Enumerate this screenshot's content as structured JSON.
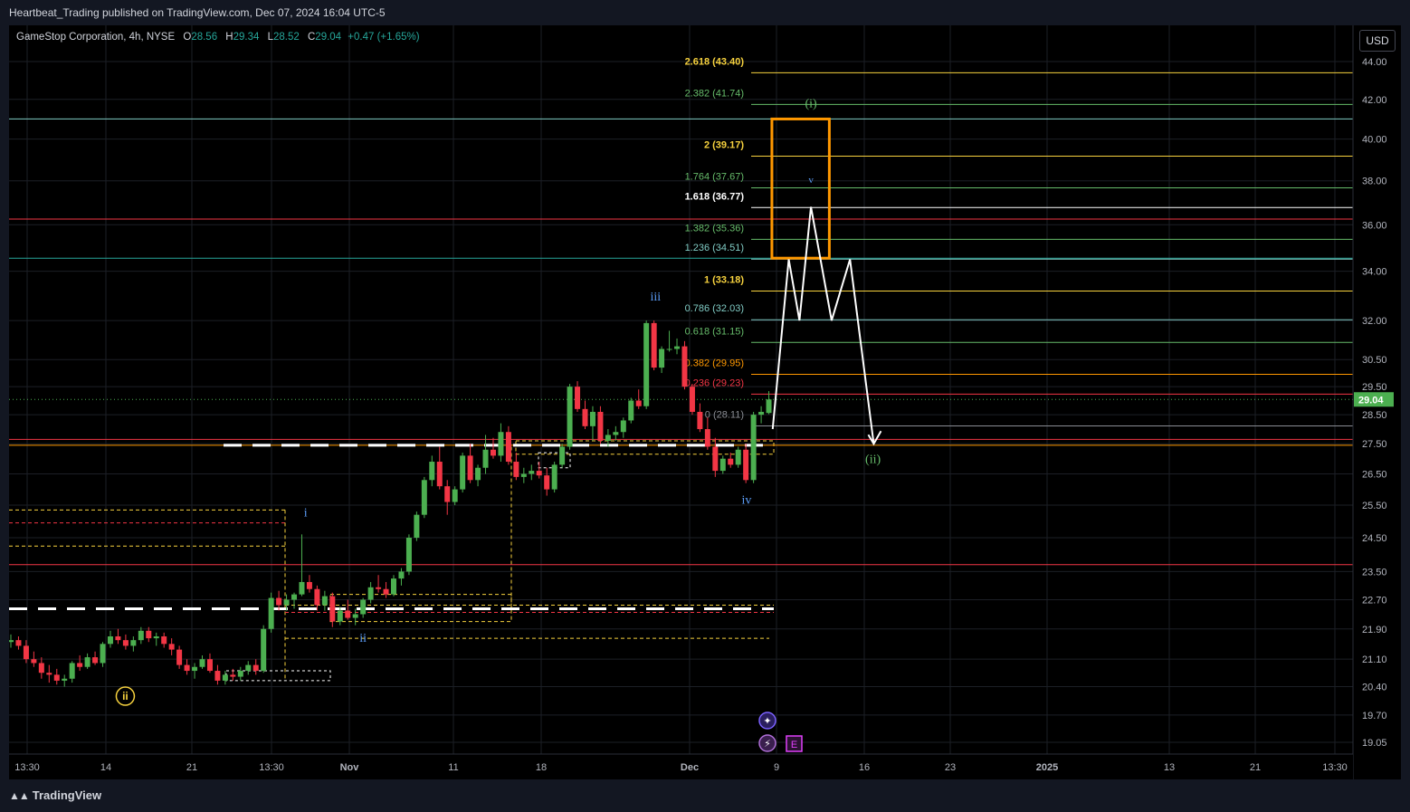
{
  "header": {
    "published_line": "Heartbeat_Trading published on TradingView.com, Dec 07, 2024 16:04 UTC-5"
  },
  "legend": {
    "symbol": "GameStop Corporation, 4h, NYSE",
    "o_label": "O",
    "o_value": "28.56",
    "h_label": "H",
    "h_value": "29.34",
    "l_label": "L",
    "l_value": "28.52",
    "c_label": "C",
    "c_value": "29.04",
    "change": "+0.47 (+1.65%)"
  },
  "currency": "USD",
  "footer": {
    "brand": "TradingView"
  },
  "colors": {
    "up": "#4caf50",
    "down": "#f23645",
    "fib_yellow": "#f7d23e",
    "fib_teal": "#80cbc4",
    "fib_green": "#66bb6a",
    "fib_orange": "#ff9800",
    "fib_red": "#f23645",
    "box": "#ff9800",
    "projection": "#ffffff",
    "wave_blue": "#5b9cf6",
    "wave_green": "#66bb6a",
    "price_tag": "#4caf50"
  },
  "chart_data": {
    "type": "candlestick",
    "price_axis": {
      "ticks": [
        44.0,
        42.0,
        40.0,
        38.0,
        36.0,
        34.0,
        32.0,
        30.5,
        29.5,
        28.5,
        27.5,
        26.5,
        25.5,
        24.5,
        23.5,
        22.7,
        21.9,
        21.1,
        20.4,
        19.7,
        19.05
      ],
      "tick_labels": [
        "44.00",
        "42.00",
        "40.00",
        "38.00",
        "36.00",
        "34.00",
        "32.00",
        "30.50",
        "29.50",
        "28.50",
        "27.50",
        "26.50",
        "25.50",
        "24.50",
        "23.50",
        "22.70",
        "21.90",
        "21.10",
        "20.40",
        "19.70",
        "19.05"
      ],
      "log_scale": true,
      "current_price": 29.04,
      "current_price_label": "29.04"
    },
    "time_axis": {
      "labels": [
        "13:30",
        "14",
        "21",
        "13:30",
        "Nov",
        "11",
        "18",
        "Dec",
        "9",
        "16",
        "23",
        "2025",
        "13",
        "21",
        "13:30"
      ],
      "bold_labels": [
        "Nov",
        "Dec",
        "2025"
      ]
    },
    "candles": [
      [
        21.55,
        21.75,
        21.4,
        21.6
      ],
      [
        21.6,
        21.7,
        21.35,
        21.45
      ],
      [
        21.45,
        21.6,
        21.0,
        21.1
      ],
      [
        21.1,
        21.3,
        20.9,
        21.0
      ],
      [
        21.0,
        21.15,
        20.6,
        20.75
      ],
      [
        20.75,
        20.95,
        20.5,
        20.7
      ],
      [
        20.7,
        20.85,
        20.45,
        20.55
      ],
      [
        20.55,
        20.7,
        20.4,
        20.6
      ],
      [
        20.6,
        21.05,
        20.5,
        21.0
      ],
      [
        21.0,
        21.2,
        20.8,
        20.9
      ],
      [
        20.9,
        21.25,
        20.85,
        21.15
      ],
      [
        21.15,
        21.3,
        20.95,
        21.0
      ],
      [
        21.0,
        21.55,
        20.9,
        21.5
      ],
      [
        21.5,
        21.85,
        21.4,
        21.7
      ],
      [
        21.7,
        21.9,
        21.5,
        21.6
      ],
      [
        21.6,
        21.75,
        21.35,
        21.45
      ],
      [
        21.45,
        21.7,
        21.3,
        21.6
      ],
      [
        21.6,
        21.95,
        21.5,
        21.85
      ],
      [
        21.85,
        21.95,
        21.55,
        21.65
      ],
      [
        21.65,
        21.8,
        21.45,
        21.7
      ],
      [
        21.7,
        21.8,
        21.4,
        21.5
      ],
      [
        21.5,
        21.65,
        21.2,
        21.35
      ],
      [
        21.35,
        21.45,
        20.85,
        20.95
      ],
      [
        20.95,
        21.1,
        20.7,
        20.8
      ],
      [
        20.8,
        21.0,
        20.6,
        20.9
      ],
      [
        20.9,
        21.2,
        20.85,
        21.1
      ],
      [
        21.1,
        21.25,
        20.75,
        20.8
      ],
      [
        20.8,
        20.95,
        20.45,
        20.55
      ],
      [
        20.55,
        20.8,
        20.45,
        20.7
      ],
      [
        20.7,
        20.85,
        20.55,
        20.65
      ],
      [
        20.65,
        20.9,
        20.55,
        20.8
      ],
      [
        20.8,
        21.05,
        20.7,
        20.95
      ],
      [
        20.95,
        21.1,
        20.7,
        20.8
      ],
      [
        20.8,
        22.0,
        20.75,
        21.9
      ],
      [
        21.9,
        22.9,
        21.8,
        22.75
      ],
      [
        22.75,
        22.95,
        22.4,
        22.55
      ],
      [
        22.55,
        22.85,
        22.4,
        22.7
      ],
      [
        22.7,
        22.9,
        22.45,
        22.85
      ],
      [
        22.85,
        24.6,
        22.8,
        23.2
      ],
      [
        23.2,
        23.4,
        22.9,
        23.0
      ],
      [
        23.0,
        23.1,
        22.4,
        22.55
      ],
      [
        22.55,
        22.95,
        22.4,
        22.8
      ],
      [
        22.8,
        22.9,
        21.95,
        22.1
      ],
      [
        22.1,
        22.5,
        22.0,
        22.4
      ],
      [
        22.4,
        22.7,
        22.15,
        22.2
      ],
      [
        22.2,
        22.45,
        22.0,
        22.3
      ],
      [
        22.3,
        22.75,
        22.2,
        22.7
      ],
      [
        22.7,
        23.2,
        22.6,
        23.05
      ],
      [
        23.05,
        23.4,
        22.9,
        23.0
      ],
      [
        23.0,
        23.2,
        22.75,
        22.85
      ],
      [
        22.85,
        23.4,
        22.8,
        23.3
      ],
      [
        23.3,
        23.6,
        23.1,
        23.5
      ],
      [
        23.5,
        24.6,
        23.4,
        24.5
      ],
      [
        24.5,
        25.3,
        24.4,
        25.2
      ],
      [
        25.2,
        26.4,
        25.1,
        26.3
      ],
      [
        26.3,
        27.1,
        26.1,
        26.9
      ],
      [
        26.9,
        27.4,
        26.0,
        26.1
      ],
      [
        26.1,
        26.3,
        25.2,
        25.6
      ],
      [
        25.6,
        26.1,
        25.5,
        26.0
      ],
      [
        26.0,
        27.2,
        25.9,
        27.1
      ],
      [
        27.1,
        27.5,
        26.2,
        26.3
      ],
      [
        26.3,
        26.8,
        26.1,
        26.7
      ],
      [
        26.7,
        27.8,
        26.5,
        27.3
      ],
      [
        27.3,
        27.7,
        27.0,
        27.1
      ],
      [
        27.1,
        28.2,
        26.9,
        27.9
      ],
      [
        27.9,
        28.1,
        26.8,
        26.9
      ],
      [
        26.9,
        27.2,
        26.3,
        26.4
      ],
      [
        26.4,
        26.7,
        26.2,
        26.5
      ],
      [
        26.5,
        26.8,
        26.3,
        26.6
      ],
      [
        26.6,
        26.9,
        26.35,
        26.45
      ],
      [
        26.45,
        26.7,
        25.8,
        26.0
      ],
      [
        26.0,
        26.9,
        25.9,
        26.8
      ],
      [
        26.8,
        27.5,
        26.7,
        27.4
      ],
      [
        27.4,
        29.6,
        27.3,
        29.5
      ],
      [
        29.5,
        29.7,
        28.6,
        28.7
      ],
      [
        28.7,
        29.0,
        28.0,
        28.1
      ],
      [
        28.1,
        28.8,
        27.6,
        28.6
      ],
      [
        28.6,
        28.8,
        27.5,
        27.6
      ],
      [
        27.6,
        28.0,
        27.4,
        27.8
      ],
      [
        27.8,
        28.1,
        27.6,
        27.9
      ],
      [
        27.9,
        28.4,
        27.7,
        28.3
      ],
      [
        28.3,
        29.1,
        28.2,
        29.0
      ],
      [
        29.0,
        29.4,
        28.7,
        28.8
      ],
      [
        28.8,
        32.0,
        28.7,
        31.9
      ],
      [
        31.9,
        32.0,
        30.1,
        30.2
      ],
      [
        30.2,
        31.0,
        30.0,
        30.9
      ],
      [
        30.9,
        31.6,
        30.8,
        30.9
      ],
      [
        30.9,
        31.3,
        30.7,
        31.0
      ],
      [
        31.0,
        31.2,
        29.4,
        29.5
      ],
      [
        29.5,
        29.6,
        28.5,
        28.6
      ],
      [
        28.6,
        28.9,
        27.9,
        28.0
      ],
      [
        28.0,
        28.4,
        27.3,
        27.4
      ],
      [
        27.4,
        27.7,
        26.4,
        26.6
      ],
      [
        26.6,
        27.1,
        26.5,
        27.0
      ],
      [
        27.0,
        27.2,
        26.7,
        26.8
      ],
      [
        26.8,
        27.4,
        26.7,
        27.3
      ],
      [
        27.3,
        27.5,
        26.2,
        26.3
      ],
      [
        26.3,
        28.6,
        26.2,
        28.5
      ],
      [
        28.5,
        28.8,
        28.2,
        28.6
      ],
      [
        28.56,
        29.34,
        28.52,
        29.04
      ]
    ],
    "fib_levels": [
      {
        "label": "2.618 (43.40)",
        "value": 43.4
      },
      {
        "label": "2.382 (41.74)",
        "value": 41.74
      },
      {
        "label": "2 (39.17)",
        "value": 39.17
      },
      {
        "label": "1.764 (37.67)",
        "value": 37.67
      },
      {
        "label": "1.618 (36.77)",
        "value": 36.77
      },
      {
        "label": "1.382 (35.36)",
        "value": 35.36
      },
      {
        "label": "1.236 (34.51)",
        "value": 34.51
      },
      {
        "label": "1 (33.18)",
        "value": 33.18
      },
      {
        "label": "0.786 (32.03)",
        "value": 32.03
      },
      {
        "label": "0.618 (31.15)",
        "value": 31.15
      },
      {
        "label": "0.382 (29.95)",
        "value": 29.95
      },
      {
        "label": "0.236 (29.23)",
        "value": 29.23
      },
      {
        "label": "0 (28.11)",
        "value": 28.11
      }
    ],
    "horizontal_lines": [
      41.0,
      36.25,
      34.55,
      27.65,
      27.45,
      23.7
    ],
    "dashed_levels": [
      27.45,
      22.45
    ],
    "target_box": {
      "from_index": 99.4,
      "to_index": 106.9,
      "top": 41.0,
      "bottom": 34.55
    },
    "projection": [
      [
        99.5,
        28.0
      ],
      [
        101.6,
        34.5
      ],
      [
        103.0,
        32.0
      ],
      [
        104.5,
        36.8
      ],
      [
        107.2,
        32.0
      ],
      [
        109.6,
        34.5
      ],
      [
        112.7,
        27.5
      ]
    ],
    "wave_labels": [
      {
        "text": "(i)",
        "index": 104.5,
        "price": 41.6
      },
      {
        "text": "v",
        "index": 104.5,
        "price": 37.9
      },
      {
        "text": "iii",
        "index": 84.2,
        "price": 32.8
      },
      {
        "text": "iv",
        "index": 96.1,
        "price": 25.55
      },
      {
        "text": "(ii)",
        "index": 112.6,
        "price": 26.85
      },
      {
        "text": "i",
        "index": 38.5,
        "price": 25.15
      },
      {
        "text": "ii",
        "index": 46.0,
        "price": 21.55
      },
      {
        "text": "ii",
        "index": 14.0,
        "price": 20.05
      }
    ]
  }
}
